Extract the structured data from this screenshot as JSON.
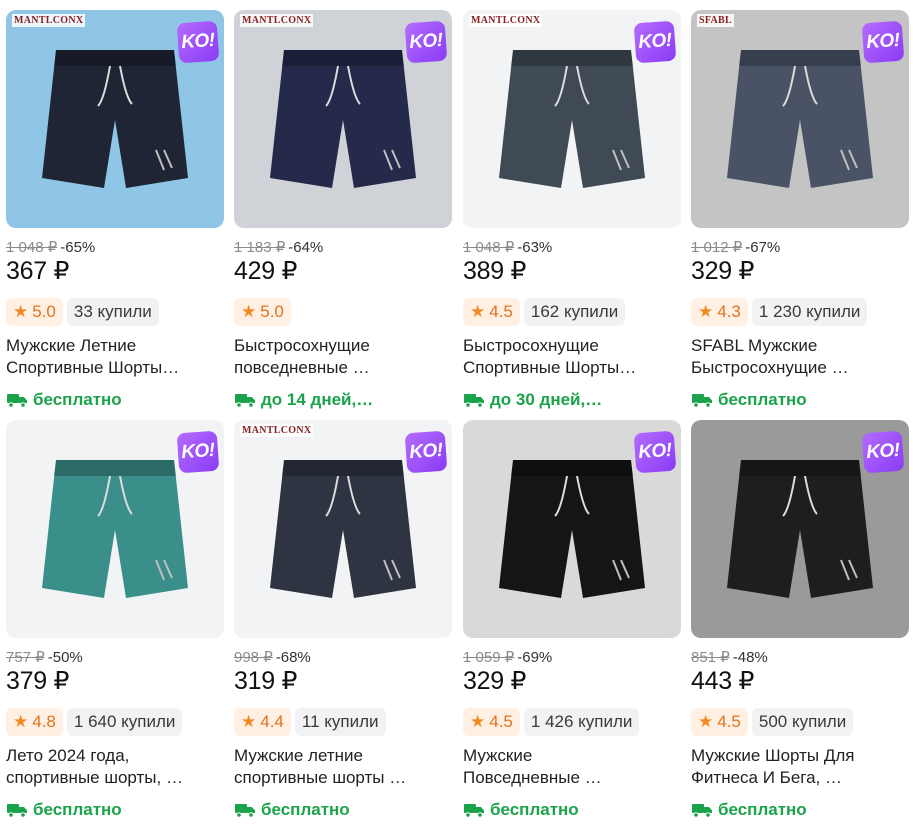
{
  "products": [
    {
      "brand": "MANTLCONX",
      "badge": "KO!",
      "old_price": "1 048 ₽",
      "discount": "-65%",
      "price": "367 ₽",
      "rating": "5.0",
      "bought": "33 купили",
      "title1": "Мужские Летние",
      "title2": "Спортивные Шорты…",
      "delivery": "бесплатно",
      "bg": "#8fc6e6",
      "fabric": "#1f2534"
    },
    {
      "brand": "MANTLCONX",
      "badge": "KO!",
      "old_price": "1 183 ₽",
      "discount": "-64%",
      "price": "429 ₽",
      "rating": "5.0",
      "bought": "",
      "title1": "Быстросохнущие",
      "title2": "повседневные …",
      "delivery": "до 14 дней,…",
      "bg": "#cfd2d6",
      "fabric": "#25294a"
    },
    {
      "brand": "MANTLCONX",
      "badge": "KO!",
      "old_price": "1 048 ₽",
      "discount": "-63%",
      "price": "389 ₽",
      "rating": "4.5",
      "bought": "162 купили",
      "title1": "Быстросохнущие",
      "title2": "Спортивные Шорты…",
      "delivery": "до 30 дней,…",
      "bg": "#f2f3f4",
      "fabric": "#3f4a54"
    },
    {
      "brand": "SFABL",
      "badge": "KO!",
      "old_price": "1 012 ₽",
      "discount": "-67%",
      "price": "329 ₽",
      "rating": "4.3",
      "bought": "1 230 купили",
      "title1": "SFABL Мужские",
      "title2": "Быстросохнущие …",
      "delivery": "бесплатно",
      "bg": "#c4c4c4",
      "fabric": "#4a5366"
    },
    {
      "brand": "",
      "badge": "KO!",
      "old_price": "757 ₽",
      "discount": "-50%",
      "price": "379 ₽",
      "rating": "4.8",
      "bought": "1 640 купили",
      "title1": "Лето 2024 года,",
      "title2": "спортивные шорты, …",
      "delivery": "бесплатно",
      "bg": "#f2f3f4",
      "fabric": "#3a8f8a"
    },
    {
      "brand": "MANTLCONX",
      "badge": "KO!",
      "old_price": "998 ₽",
      "discount": "-68%",
      "price": "319 ₽",
      "rating": "4.4",
      "bought": "11 купили",
      "title1": "Мужские летние",
      "title2": "спортивные шорты …",
      "delivery": "бесплатно",
      "bg": "#f2f3f4",
      "fabric": "#2e3442"
    },
    {
      "brand": "",
      "badge": "KO!",
      "old_price": "1 059 ₽",
      "discount": "-69%",
      "price": "329 ₽",
      "rating": "4.5",
      "bought": "1 426 купили",
      "title1": "Мужские",
      "title2": "Повседневные …",
      "delivery": "бесплатно",
      "bg": "#d9d9d9",
      "fabric": "#151515"
    },
    {
      "brand": "",
      "badge": "KO!",
      "old_price": "851 ₽",
      "discount": "-48%",
      "price": "443 ₽",
      "rating": "4.5",
      "bought": "500 купили",
      "title1": "Мужские Шорты Для",
      "title2": "Фитнеса И Бега, …",
      "delivery": "бесплатно",
      "bg": "#9a9a9a",
      "fabric": "#1e1e1e"
    }
  ],
  "colors": {
    "rating": "#e0731d",
    "delivery": "#1aa34a",
    "badge": "#9a4cf7"
  },
  "icons": {
    "rating": "star-icon",
    "delivery": "truck-icon",
    "badge": "ko-badge-icon"
  }
}
